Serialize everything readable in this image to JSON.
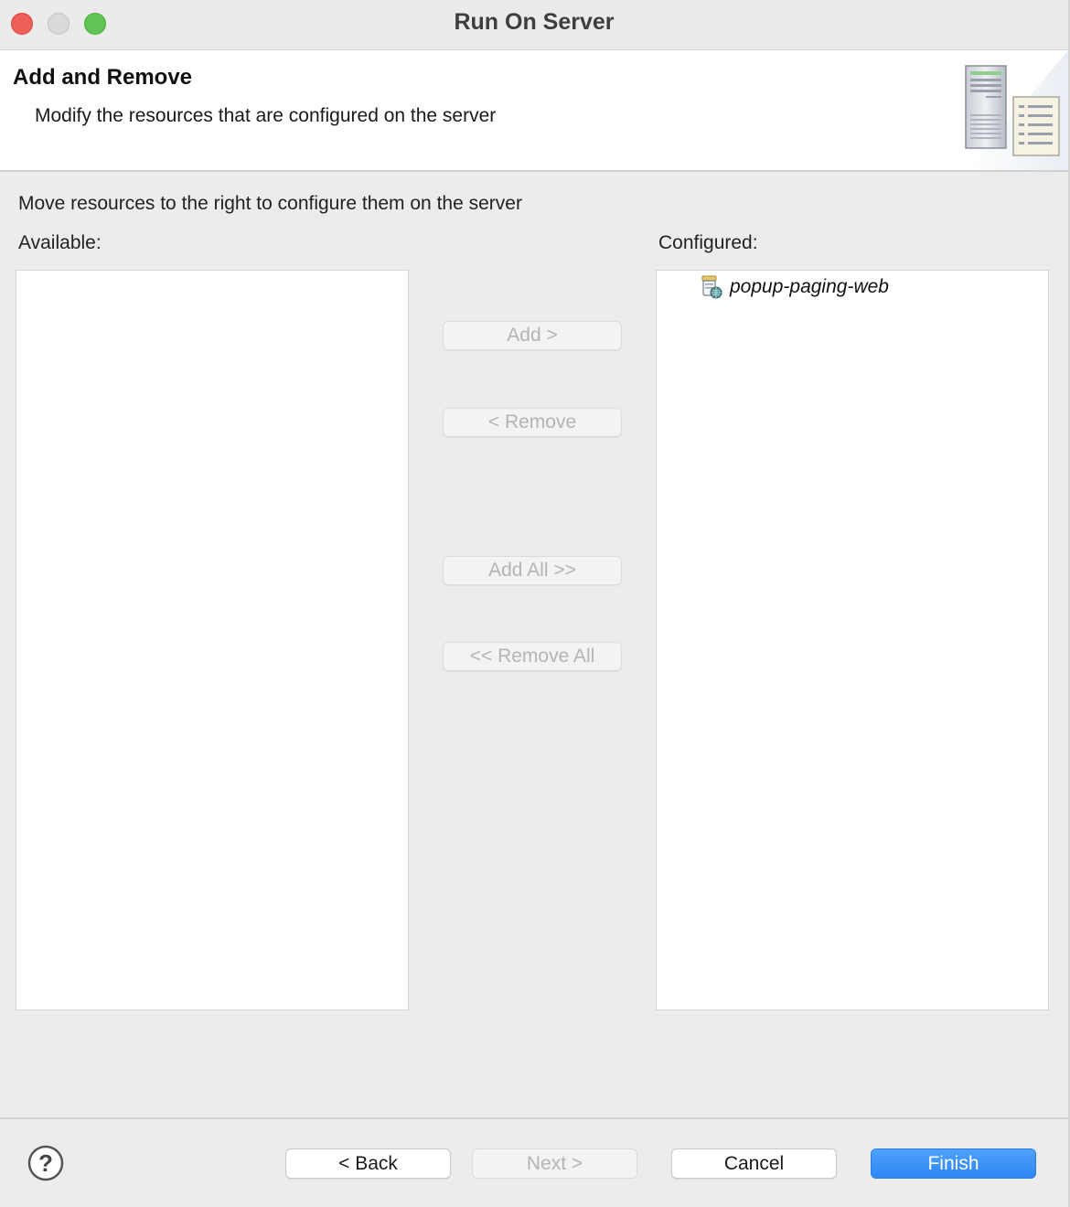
{
  "window": {
    "title": "Run On Server"
  },
  "banner": {
    "title": "Add and Remove",
    "description": "Modify the resources that are configured on the server",
    "icon": "server-wizard-icon"
  },
  "main": {
    "instructions": "Move resources to the right to configure them on the server",
    "available_label": "Available:",
    "configured_label": "Configured:",
    "available_items": [],
    "configured_items": [
      {
        "label": "popup-paging-web",
        "icon": "web-module-icon"
      }
    ]
  },
  "buttons": {
    "add": "Add >",
    "remove": "< Remove",
    "add_all": "Add All >>",
    "remove_all": "<< Remove All"
  },
  "footer": {
    "help_icon": "help-icon",
    "back": "< Back",
    "next": "Next >",
    "cancel": "Cancel",
    "finish": "Finish"
  },
  "colors": {
    "accent": "#2f86f5",
    "close": "#ee5f57",
    "zoom": "#5fc453",
    "disabled_text": "#b4b4b4"
  }
}
